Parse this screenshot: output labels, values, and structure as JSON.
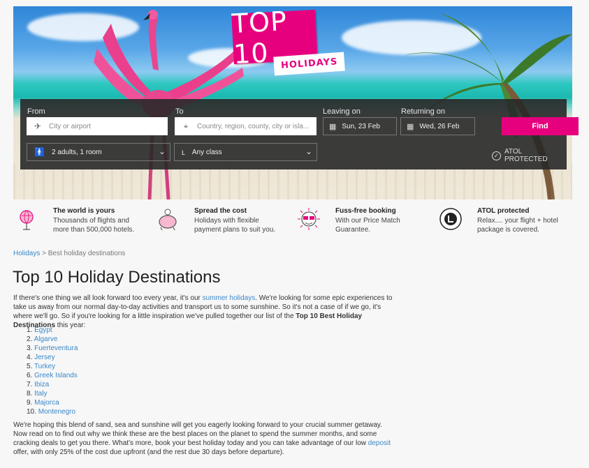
{
  "hero": {
    "badge_title": "TOP 10",
    "badge_subtitle": "HOLIDAYS"
  },
  "search": {
    "from_label": "From",
    "from_placeholder": "City or airport",
    "to_label": "To",
    "to_placeholder": "Country, region, county, city or isla...",
    "leaving_label": "Leaving on",
    "leaving_value": "Sun, 23 Feb",
    "returning_label": "Returning on",
    "returning_value": "Wed, 26 Feb",
    "find_label": "Find",
    "guests_value": "2 adults, 1 room",
    "class_value": "Any class",
    "atol_text": "ATOL PROTECTED",
    "accent": "#e6007e"
  },
  "features": [
    {
      "icon": "globe-icon",
      "title": "The world is yours",
      "desc": "Thousands of flights and more than 500,000 hotels."
    },
    {
      "icon": "piggy-bank-icon",
      "title": "Spread the cost",
      "desc": "Holidays with flexible payment plans to suit you."
    },
    {
      "icon": "sunglasses-icon",
      "title": "Fuss-free booking",
      "desc": "With our Price Match Guarantee."
    },
    {
      "icon": "atol-badge-icon",
      "title": "ATOL protected",
      "desc": "Relax.... your flight + hotel package is covered."
    }
  ],
  "breadcrumb": {
    "root": "Holidays",
    "separator": ">",
    "current": "Best holiday destinations"
  },
  "article": {
    "title": "Top 10 Holiday Destinations",
    "intro_1": "If there's one thing we all look forward too every year, it's our ",
    "intro_link": "summer holidays",
    "intro_2": ".  We're looking for some epic experiences to take us away from our normal day-to-day activities and transport us to some sunshine. So it's not a case of if we go, it's where we'll go. So if you're looking for a little inspiration we've pulled together our list of the ",
    "intro_bold": "Top 10 Best Holiday Destinations",
    "intro_3": " this year:",
    "destinations": [
      "Egypt",
      "Algarve",
      "Fuerteventura",
      "Jersey",
      "Turkey",
      "Greek Islands",
      "Ibiza",
      "Italy",
      "Majorca",
      "Montenegro"
    ],
    "outro_1": "We're hoping this blend of sand, sea and sunshine will get you eagerly looking forward to your crucial summer getaway. Now read on to find out why we think these are the best places on the planet to spend the summer months, and some cracking deals to get you there. What's more, book your best holiday today and you can take advantage of our low ",
    "outro_link": "deposit",
    "outro_2": " offer, with only 25% of the cost due upfront (and the rest due 30 days before departure)."
  }
}
